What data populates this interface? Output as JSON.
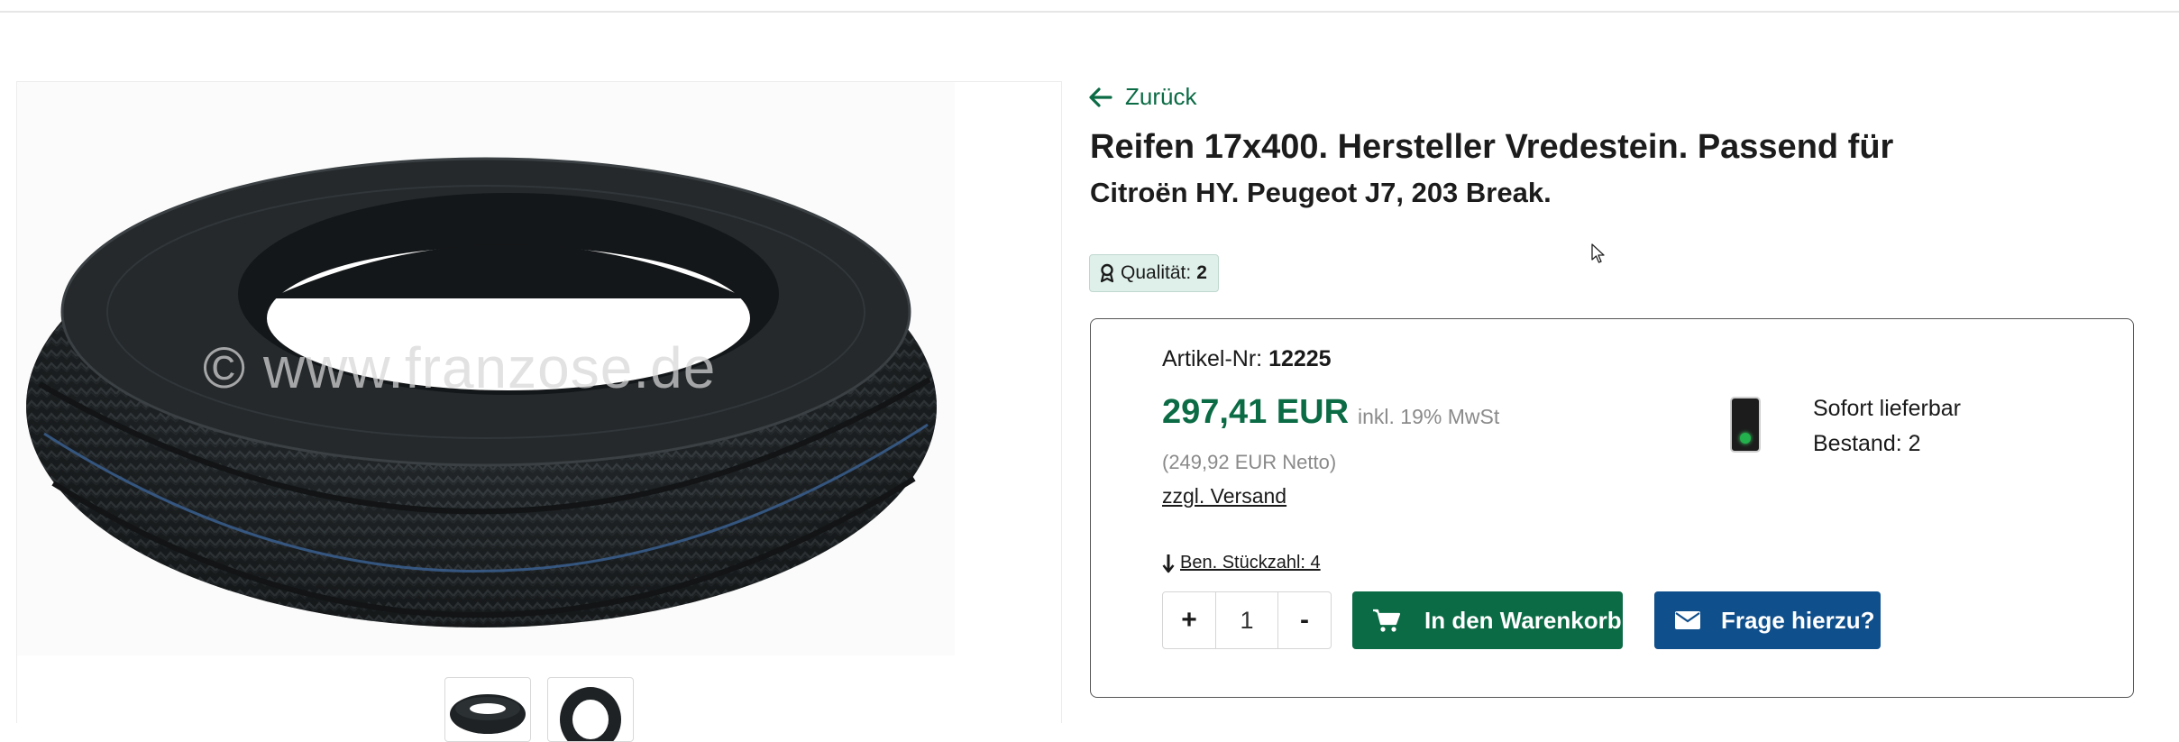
{
  "back_link": {
    "label": "Zurück",
    "icon": "arrow-left-icon"
  },
  "product": {
    "title_line1": "Reifen 17x400. Hersteller Vredestein. Passend für",
    "title_line2": "Citroën HY. Peugeot J7, 203 Break.",
    "image_watermark": "© www.franzose.de",
    "thumbnails": [
      "tire-thumbnail-1",
      "tire-thumbnail-2"
    ]
  },
  "quality": {
    "icon": "award-icon",
    "label": "Qualität:",
    "value": "2"
  },
  "purchase_panel": {
    "article_label": "Artikel-Nr:",
    "article_number": "12225",
    "price": "297,41 EUR",
    "vat_note": "inkl. 19% MwSt",
    "net_price": "(249,92 EUR Netto)",
    "shipping_link": "zzgl. Versand",
    "availability": "Sofort lieferbar",
    "stock": "Bestand: 2",
    "required_pieces": "Ben. Stückzahl: 4",
    "quantity": {
      "increment": "+",
      "value": "1",
      "decrement": "-"
    },
    "add_to_cart_label": "In den Warenkorb",
    "ask_question_label": "Frage hierzu?"
  },
  "colors": {
    "accent_green": "#0b6b45",
    "button_blue": "#0f4f8c",
    "badge_bg": "#dff0ea",
    "traffic_light_green": "#22b14c"
  }
}
